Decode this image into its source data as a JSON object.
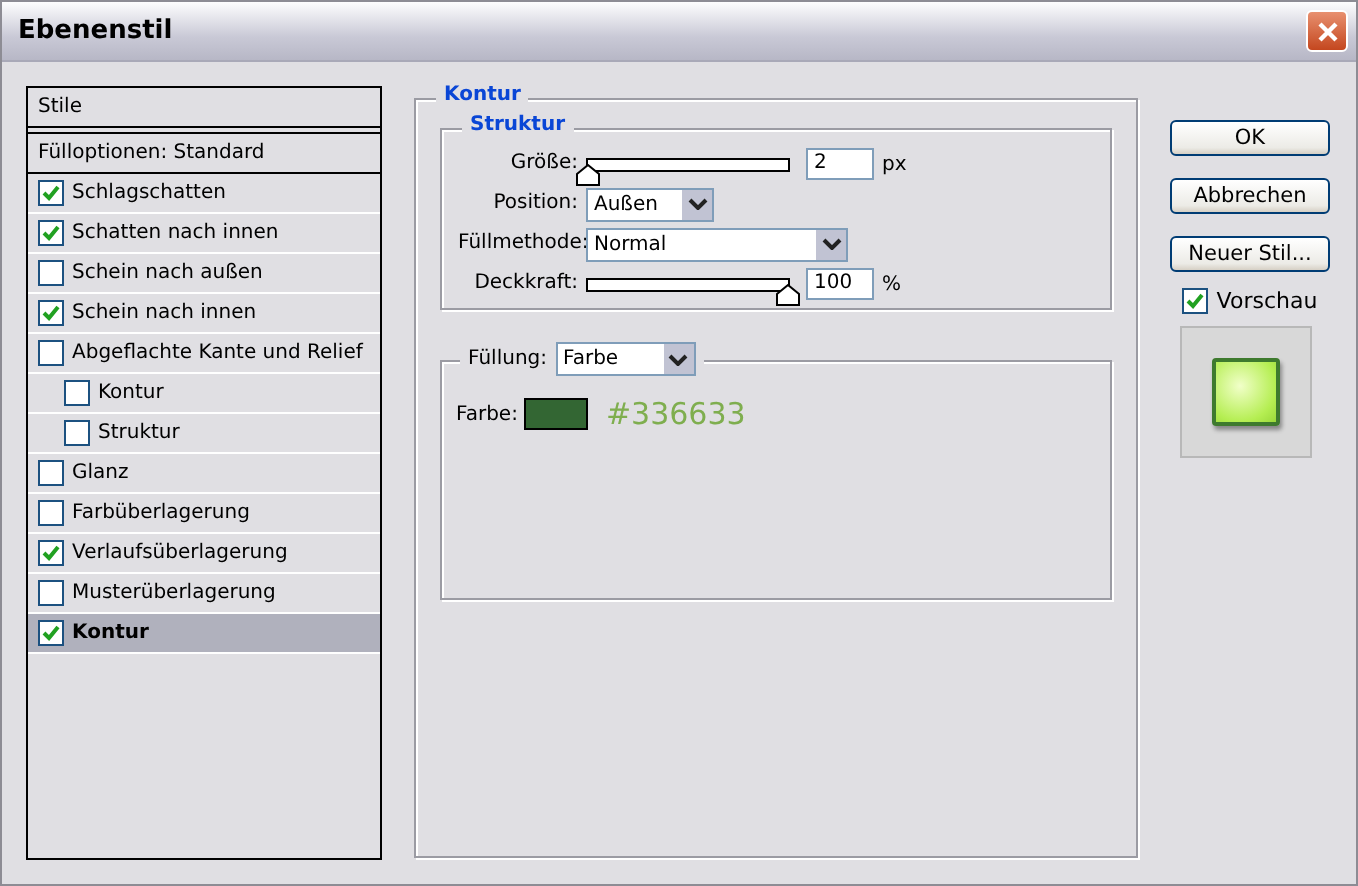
{
  "window": {
    "title": "Ebenenstil"
  },
  "styles": [
    {
      "kind": "heading",
      "label": "Stile",
      "selected": false
    },
    {
      "kind": "option",
      "label": "Fülloptionen: Standard",
      "selected": false
    },
    {
      "kind": "effect",
      "label": "Schlagschatten",
      "checked": true,
      "selected": false
    },
    {
      "kind": "effect",
      "label": "Schatten nach innen",
      "checked": true,
      "selected": false
    },
    {
      "kind": "effect",
      "label": "Schein nach außen",
      "checked": false,
      "selected": false
    },
    {
      "kind": "effect",
      "label": "Schein nach innen",
      "checked": true,
      "selected": false
    },
    {
      "kind": "effect",
      "label": "Abgeflachte Kante und Relief",
      "checked": false,
      "selected": false,
      "children": [
        {
          "kind": "effect",
          "label": "Kontur",
          "checked": false,
          "selected": false
        },
        {
          "kind": "effect",
          "label": "Struktur",
          "checked": false,
          "selected": false
        }
      ]
    },
    {
      "kind": "effect",
      "label": "Glanz",
      "checked": false,
      "selected": false
    },
    {
      "kind": "effect",
      "label": "Farbüberlagerung",
      "checked": false,
      "selected": false
    },
    {
      "kind": "effect",
      "label": "Verlaufsüberlagerung",
      "checked": true,
      "selected": false
    },
    {
      "kind": "effect",
      "label": "Musterüberlagerung",
      "checked": false,
      "selected": false
    },
    {
      "kind": "effect",
      "label": "Kontur",
      "checked": true,
      "selected": true
    }
  ],
  "panel": {
    "title": "Kontur",
    "structure": {
      "title": "Struktur",
      "size": {
        "label": "Größe:",
        "level": 0,
        "value": "2",
        "unit": "px"
      },
      "position": {
        "label": "Position:",
        "value": "Außen"
      },
      "blend_mode": {
        "label": "Füllmethode:",
        "value": "Normal"
      },
      "opacity": {
        "label": "Deckkraft:",
        "level": 1,
        "value": "100",
        "unit": "%"
      }
    },
    "fill": {
      "label": "Füllung:",
      "value": "Farbe",
      "color_label": "Farbe:",
      "color": "#336633",
      "color_text": "#336633"
    }
  },
  "buttons": [
    "OK",
    "Abbrechen",
    "Neuer Stil..."
  ],
  "preview": {
    "label": "Vorschau",
    "checked": true
  }
}
